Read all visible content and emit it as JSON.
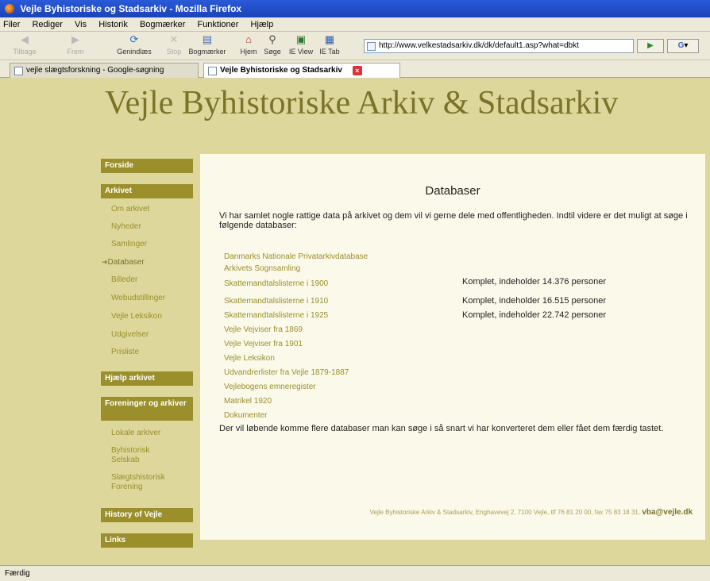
{
  "window": {
    "title": "Vejle Byhistoriske og Stadsarkiv - Mozilla Firefox"
  },
  "menu": [
    "Filer",
    "Rediger",
    "Vis",
    "Historik",
    "Bogmærker",
    "Funktioner",
    "Hjælp"
  ],
  "toolbar": {
    "back": "Tilbage",
    "forward": "Frem",
    "reload": "Genindlæs",
    "stop": "Stop",
    "bookmarks": "Bogmærker",
    "home": "Hjem",
    "search": "Søge",
    "ie_view": "IE View",
    "ie_tab": "IE Tab",
    "url": "http://www.velkestadsarkiv.dk/dk/default1.asp?what=dbkt",
    "go": "▶"
  },
  "tabs": [
    {
      "label": "vejle slægtsforskning - Google-søgning"
    },
    {
      "label": "Vejle Byhistoriske og Stadsarkiv"
    }
  ],
  "site": {
    "title": "Vejle Byhistoriske Arkiv & Stadsarkiv"
  },
  "nav": {
    "forside": "Forside",
    "arkivet": "Arkivet",
    "arkivet_items": [
      "Om arkivet",
      "Nyheder",
      "Samlinger",
      "Databaser",
      "Billeder",
      "Webudstillinger",
      "Vejle Leksikon",
      "Udgivelser",
      "Prisliste"
    ],
    "current_arrow": "➜",
    "hjaelp": "Hjælp arkivet",
    "foreninger": "Foreninger og arkiver",
    "foreninger_items": [
      "Lokale arkiver",
      "Byhistorisk Selskab",
      "Slægtshistorisk Forening"
    ],
    "history": "History of Vejle",
    "links": "Links"
  },
  "main": {
    "title": "Databaser",
    "intro": "Vi har samlet nogle rattige data på arkivet og dem vil vi gerne dele med offentligheden. Indtil videre er det muligt at søge i følgende databaser:",
    "databases": [
      {
        "name": "Danmarks Nationale Privatarkivdatabase",
        "note": ""
      },
      {
        "name": "Arkivets Sognsamling",
        "note": ""
      },
      {
        "name": "Skattemandtalslisterne i 1900",
        "note": "Komplet, indeholder 14.376 personer"
      },
      {
        "name": "Skattemandtalslisterne i 1910",
        "note": "Komplet, indeholder 16.515 personer"
      },
      {
        "name": "Skattemandtalslisterne i 1925",
        "note": "Komplet, indeholder 22.742 personer"
      },
      {
        "name": "Vejle Vejviser fra 1869",
        "note": ""
      },
      {
        "name": "Vejle Vejviser fra 1901",
        "note": ""
      },
      {
        "name": "Vejle Leksikon",
        "note": ""
      },
      {
        "name": "Udvandrerlister fra Vejle 1879-1887",
        "note": ""
      },
      {
        "name": "Vejlebogens emneregister",
        "note": ""
      },
      {
        "name": "Matrikel 1920",
        "note": ""
      },
      {
        "name": "Dokumenter",
        "note": ""
      }
    ],
    "more": "Der vil løbende komme flere databaser man kan søge i så snart vi har konverteret dem eller fået dem færdig tastet.",
    "footer": "Vejle Byhistoriske Arkiv & Stadsarkiv, Enghavevej 2, 7100 Vejle, tlf 76 81 20 00, fax 75 83 18 31, ",
    "footer_email": "vba@vejle.dk"
  },
  "status": "Færdig"
}
